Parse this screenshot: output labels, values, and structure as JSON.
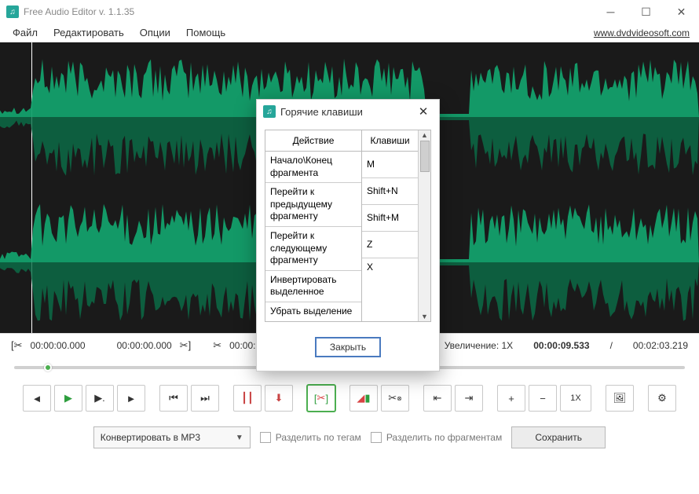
{
  "app": {
    "title": "Free Audio Editor v. 1.1.35",
    "website": "www.dvdvideosoft.com"
  },
  "menu": {
    "file": "Файл",
    "edit": "Редактировать",
    "options": "Опции",
    "help": "Помощь"
  },
  "timebar": {
    "sel_start": "00:00:00.000",
    "sel_end": "00:00:00.000",
    "cut_time": "00:00:00.000",
    "zoom_label": "Увеличение: 1X",
    "current": "00:00:09.533",
    "separator": "/",
    "total": "00:02:03.219"
  },
  "buttons": {
    "zoom_1x": "1X"
  },
  "bottom": {
    "convert_label": "Конвертировать в MP3",
    "split_tags": "Разделить по тегам",
    "split_fragments": "Разделить по фрагментам",
    "save": "Сохранить"
  },
  "dialog": {
    "title": "Горячие клавиши",
    "col_action": "Действие",
    "col_keys": "Клавиши",
    "close": "Закрыть",
    "rows": [
      {
        "action": "Начало\\Конец фрагмента",
        "key": "M"
      },
      {
        "action": "Перейти к предыдущему фрагменту",
        "key": "Shift+N"
      },
      {
        "action": "Перейти к следующему фрагменту",
        "key": "Shift+M"
      },
      {
        "action": "Инвертировать выделенное",
        "key": "Z"
      },
      {
        "action": "Убрать выделение",
        "key": "X"
      }
    ]
  }
}
